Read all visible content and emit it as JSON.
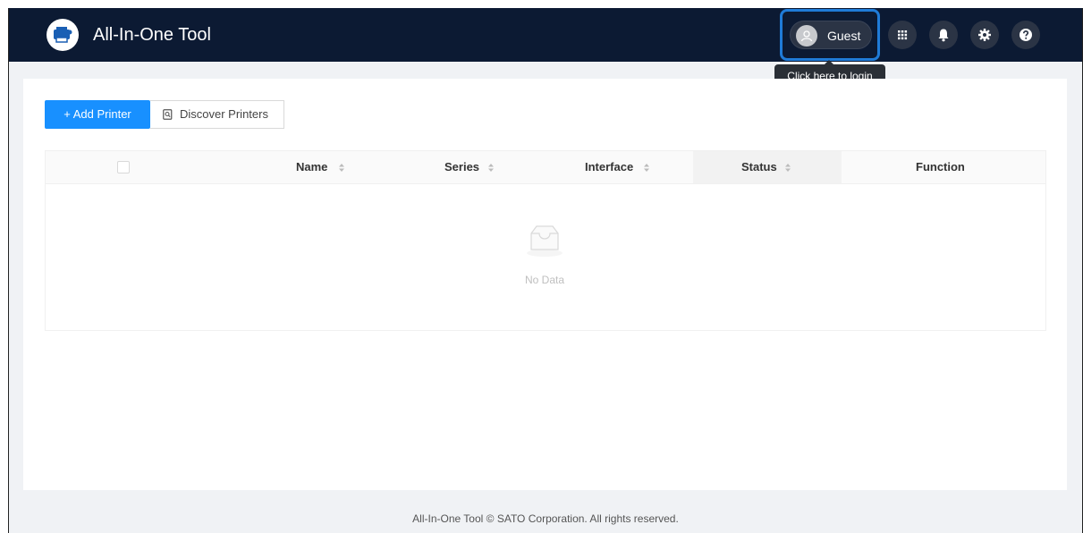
{
  "header": {
    "app_title": "All-In-One Tool",
    "user_label": "Guest",
    "login_tooltip": "Click here to login",
    "icons": [
      "apps-grid-icon",
      "bell-icon",
      "gear-icon",
      "help-icon"
    ]
  },
  "toolbar": {
    "add_printer_label": "+ Add Printer",
    "discover_printers_label": "Discover Printers"
  },
  "table": {
    "columns": [
      {
        "label": "Name",
        "sortable": true
      },
      {
        "label": "Series",
        "sortable": true
      },
      {
        "label": "Interface",
        "sortable": true
      },
      {
        "label": "Status",
        "sortable": true
      },
      {
        "label": "Function",
        "sortable": false
      }
    ],
    "empty_text": "No Data"
  },
  "footer": {
    "text": "All-In-One Tool © SATO Corporation. All rights reserved."
  },
  "colors": {
    "header_bg": "#0c1a33",
    "primary": "#1890ff",
    "highlight": "#1f7bd8"
  }
}
